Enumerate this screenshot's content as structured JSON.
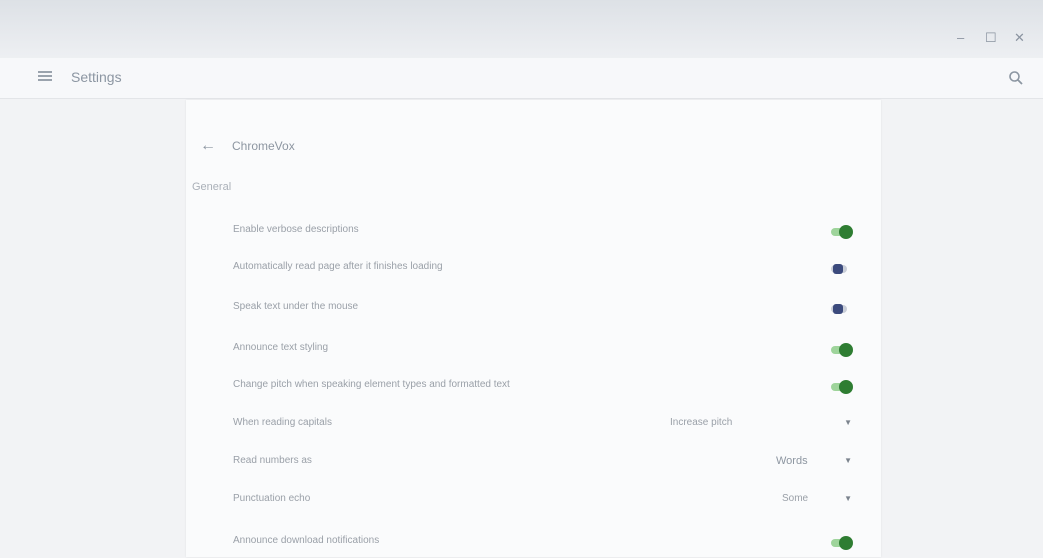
{
  "window": {
    "minimize_glyph": "–",
    "maximize_glyph": "☐",
    "close_glyph": "✕"
  },
  "appbar": {
    "title": "Settings",
    "menu_icon": "hamburger-menu-icon",
    "search_icon": "search-icon"
  },
  "page": {
    "title": "ChromeVox",
    "back_glyph": "←",
    "section_general": "General"
  },
  "settings": [
    {
      "label": "Enable verbose descriptions",
      "control": "toggle",
      "on": true
    },
    {
      "label": "Automatically read page after it finishes loading",
      "control": "toggle",
      "on": false
    },
    {
      "label": "Speak text under the mouse",
      "control": "toggle",
      "on": false
    },
    {
      "label": "Announce text styling",
      "control": "toggle",
      "on": true
    },
    {
      "label": "Change pitch when speaking element types and formatted text",
      "control": "toggle",
      "on": true
    },
    {
      "label": "When reading capitals",
      "control": "select",
      "value": "Increase pitch"
    },
    {
      "label": "Read numbers as",
      "control": "select",
      "value": "Words"
    },
    {
      "label": "Punctuation echo",
      "control": "select",
      "value": "Some"
    },
    {
      "label": "Announce download notifications",
      "control": "toggle",
      "on": true
    }
  ],
  "colors": {
    "toggle_on_knob": "#2e7d32",
    "toggle_on_track": "#9ed49b",
    "toggle_off_knob": "#3b4a7d",
    "toggle_off_track": "#c9ced8"
  }
}
